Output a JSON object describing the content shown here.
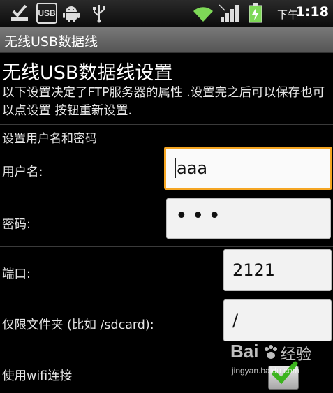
{
  "status_bar": {
    "ampm": "下午",
    "time": "1:18",
    "usb_icon_label": "USB",
    "left_icons": [
      "download-done-icon",
      "usb-debug-icon",
      "android-icon",
      "usb-connection-icon"
    ],
    "right_icons": [
      "wifi-icon",
      "signal-icon",
      "battery-charging-icon"
    ]
  },
  "app": {
    "title": "无线USB数据线"
  },
  "page": {
    "heading": "无线USB数据线设置",
    "description": "以下设置决定了FTP服务器的属性 .设置完之后可以保存也可以点设置 按钮重新设置."
  },
  "credentials": {
    "section_title": "设置用户名和密码",
    "username_label": "用户名:",
    "username_value": "aaa",
    "password_label": "密码:",
    "password_value": "•••"
  },
  "server": {
    "port_label": "端口:",
    "port_value": "2121",
    "folder_label": "仅限文件夹 (比如 /sdcard):",
    "folder_value": "/"
  },
  "wifi": {
    "label": "使用wifi连接",
    "checked": true
  },
  "watermark": {
    "brand": "Bai",
    "brand2": "经验",
    "url": "jingyan.baidu.com"
  },
  "colors": {
    "focus_border": "#f5a623",
    "check_green": "#3cb41e",
    "wifi_green": "#7ed957",
    "titlebar": "#6b6b6b"
  }
}
